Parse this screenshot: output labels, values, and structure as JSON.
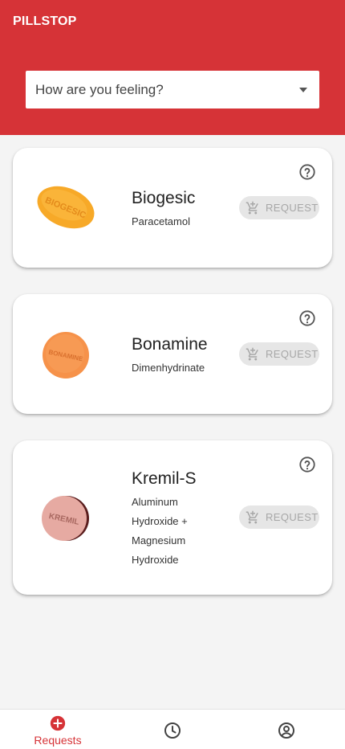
{
  "app": {
    "title": "PILLSTOP"
  },
  "search": {
    "placeholder": "How are you feeling?"
  },
  "medicines": [
    {
      "name": "Biogesic",
      "generic": "Paracetamol",
      "request_label": "REQUEST",
      "pill_imprint": "BIOGESIC",
      "pill_color": "#f7a928"
    },
    {
      "name": "Bonamine",
      "generic": "Dimenhydrinate",
      "request_label": "REQUEST",
      "pill_imprint": "BONAMINE",
      "pill_color": "#f6924a"
    },
    {
      "name": "Kremil-S",
      "generic": "Aluminum Hydroxide + Magnesium Hydroxide",
      "request_label": "REQUEST",
      "pill_imprint": "KREMIL",
      "pill_color": "#e6aaa2"
    }
  ],
  "bottom_nav": [
    {
      "label": "Requests",
      "icon": "add-circle-icon",
      "active": true
    },
    {
      "label": "",
      "icon": "clock-icon",
      "active": false
    },
    {
      "label": "",
      "icon": "account-circle-icon",
      "active": false
    }
  ],
  "colors": {
    "primary": "#d63337",
    "background": "#f4f4f4",
    "button_disabled_bg": "#e6e6e6",
    "button_disabled_text": "#a7a7a7"
  }
}
